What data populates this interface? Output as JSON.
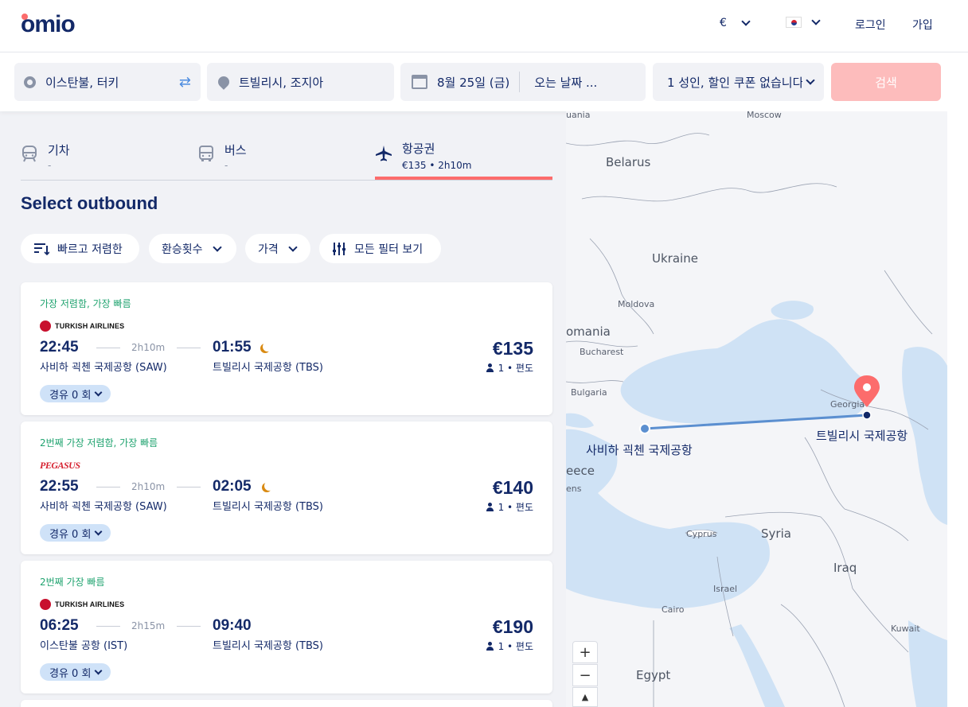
{
  "header": {
    "logo": "omio",
    "currency": "€",
    "login": "로그인",
    "signup": "가입"
  },
  "search": {
    "from": "이스탄불, 터키",
    "to": "트빌리시, 조지아",
    "depart_date": "8월 25일 (금)",
    "return_date": "오는 날짜 ...",
    "passengers": "1 성인, 할인 쿠폰 없습니다",
    "search_label": "검색"
  },
  "tabs": [
    {
      "label": "기차",
      "sub": "-",
      "icon": "train-icon"
    },
    {
      "label": "버스",
      "sub": "-",
      "icon": "bus-icon"
    },
    {
      "label": "항공권",
      "sub": "€135 • 2h10m",
      "icon": "plane-icon"
    }
  ],
  "section_title": "Select outbound",
  "filters": {
    "sort": "빠르고 저렴한",
    "transfers": "환승횟수",
    "price": "가격",
    "all_filters": "모든 필터 보기"
  },
  "results": [
    {
      "badge": "가장 저렴함,  가장 빠름",
      "airline": "TURKISH AIRLINES",
      "dep_time": "22:45",
      "duration": "2h10m",
      "arr_time": "01:55",
      "overnight": true,
      "dep_airport": "사비하 괵첸 국제공항 (SAW)",
      "arr_airport": "트빌리시 국제공항 (TBS)",
      "price": "€135",
      "pax": "1 • 편도",
      "stops": "경유 0 회"
    },
    {
      "badge": "2번째 가장 저렴함,  가장 빠름",
      "airline": "PEGASUS",
      "dep_time": "22:55",
      "duration": "2h10m",
      "arr_time": "02:05",
      "overnight": true,
      "dep_airport": "사비하 괵첸 국제공항 (SAW)",
      "arr_airport": "트빌리시 국제공항 (TBS)",
      "price": "€140",
      "pax": "1 • 편도",
      "stops": "경유 0 회"
    },
    {
      "badge": "2번째 가장 빠름",
      "airline": "TURKISH AIRLINES",
      "dep_time": "06:25",
      "duration": "2h15m",
      "arr_time": "09:40",
      "overnight": false,
      "dep_airport": "이스탄불 공항 (IST)",
      "arr_airport": "트빌리시 국제공항 (TBS)",
      "price": "€190",
      "pax": "1 • 편도",
      "stops": "경유 0 회"
    }
  ],
  "map": {
    "labels": {
      "moscow": "Moscow",
      "belarus": "Belarus",
      "ukraine": "Ukraine",
      "moldova": "Moldova",
      "romania": "omania",
      "bucharest": "Bucharest",
      "bulgaria": "Bulgaria",
      "georgia": "Georgia",
      "greece": "eece",
      "athens": "ens",
      "cyprus": "Cyprus",
      "syria": "Syria",
      "iraq": "Iraq",
      "israel": "Israel",
      "cairo": "Cairo",
      "kuwait": "Kuwait",
      "egypt": "Egypt",
      "lithuania": "uania"
    },
    "origin_label": "사비하 괵첸 국제공항",
    "destination_label": "트빌리시 국제공항",
    "zoom_in": "+",
    "zoom_out": "−",
    "route_color": "#5b8fd0",
    "water_color": "#cfe2f5",
    "pin_color": "#fc6c6c"
  },
  "colors": {
    "brand": "#132968",
    "accent": "#fc6c6c",
    "badge_green": "#1fa36f"
  }
}
